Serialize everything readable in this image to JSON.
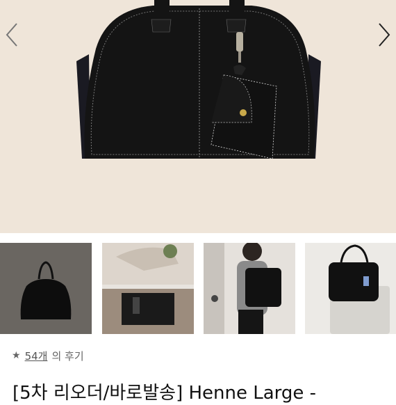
{
  "product": {
    "review_star": "★",
    "review_count": "54개",
    "review_suffix": "의 후기",
    "title": "[5차 리오더/바로발송] Henne Large -"
  },
  "gallery": {
    "prev_icon": "chevron-left-icon",
    "next_icon": "chevron-right-icon",
    "thumbnails": [
      "bag-front-thumbnail",
      "bag-interior-thumbnail",
      "bag-model-thumbnail",
      "bag-luggage-thumbnail"
    ]
  },
  "colors": {
    "hero_background": "#efe5d9",
    "bag": "#141414"
  }
}
